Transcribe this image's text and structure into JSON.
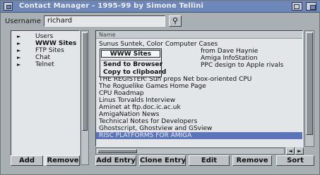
{
  "window": {
    "title": "Contact Manager - 1995-99 by Simone Tellini"
  },
  "username": {
    "label": "Username",
    "value": "richard"
  },
  "tree": {
    "items": [
      {
        "label": "Users",
        "selected": false
      },
      {
        "label": "WWW Sites",
        "selected": true
      },
      {
        "label": "FTP Sites",
        "selected": false
      },
      {
        "label": "Chat",
        "selected": false
      },
      {
        "label": "Telnet",
        "selected": false
      }
    ]
  },
  "list": {
    "header": "Name",
    "rows": [
      "Sunus Suntek, Color Computer Cases",
      "from Dave Haynie",
      "Amiga InfoStation",
      "PPC design to Apple rivals",
      "",
      "THE REGISTER: Sun preps Net box-oriented CPU",
      "The Roguelike Games Home Page",
      "CPU Roadmap",
      "Linus Torvalds Interview",
      "Aminet at ftp.doc.ic.ac.uk",
      "AmigaNation News",
      "Technical Notes for Developers",
      "Ghostscript, Ghostview and GSview",
      "RISC PLATFORMS FOR AMIGA"
    ],
    "selected_index": 13
  },
  "popup": {
    "title": "WWW Sites",
    "items": [
      "Send to Browser",
      "Copy to clipboard"
    ]
  },
  "buttons": {
    "add": "Add",
    "remove_tree": "Remove",
    "add_entry": "Add Entry",
    "clone_entry": "Clone Entry",
    "edit": "Edit",
    "remove": "Remove",
    "sort": "Sort"
  },
  "icons": {
    "close": "close-gadget-icon",
    "zoom": "zoom-gadget-icon",
    "depth": "depth-gadget-icon",
    "find": "magnifier-icon",
    "expand": "triangle-right-icon"
  },
  "colors": {
    "titlebar": "#6d87b9",
    "selection": "#5c74b9",
    "panel": "#e2e6e8",
    "window": "#a9b0b4"
  }
}
